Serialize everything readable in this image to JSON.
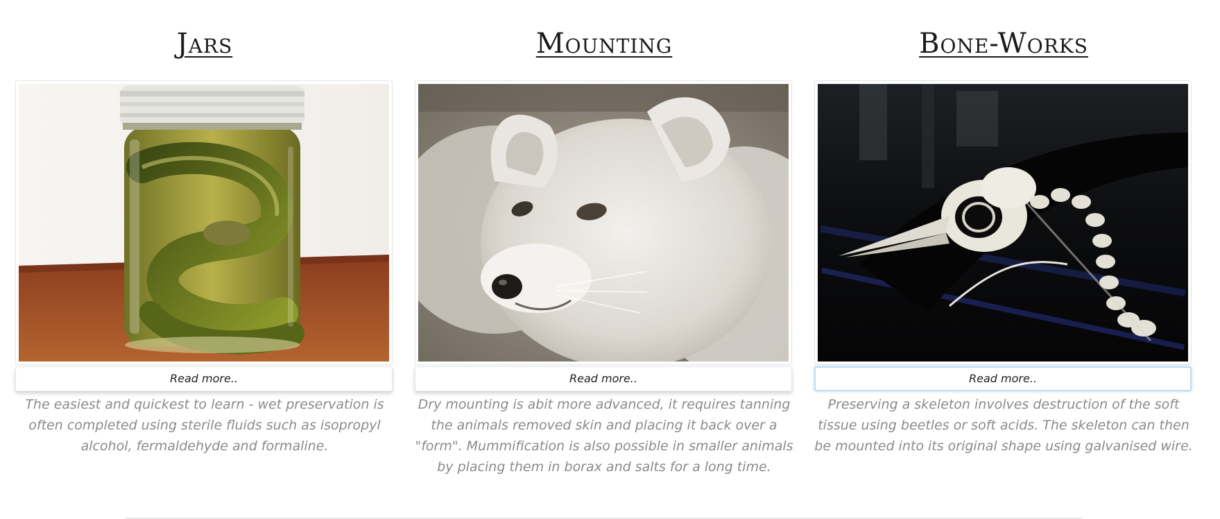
{
  "cards": [
    {
      "title": "Jars",
      "image_subject": "snake-in-jar-photo",
      "button_label": "Read more..",
      "description": "The easiest and quickest to learn - wet preservation is often completed using sterile fluids such as isopropyl alcohol, fermaldehyde and formaline."
    },
    {
      "title": "Mounting",
      "image_subject": "arctic-fox-photo",
      "button_label": "Read more..",
      "description": "Dry mounting is abit more advanced, it requires tanning the animals removed skin and placing it back over a \"form\". Mummification is also possible in smaller animals by placing them in borax and salts for a long time."
    },
    {
      "title": "Bone-Works",
      "image_subject": "bird-skeleton-photo",
      "button_label": "Read more..",
      "description": "Preserving a skeleton involves destruction of the soft tissue using beetles or soft acids. The skeleton can then be mounted into its original shape using galvanised wire."
    }
  ],
  "colors": {
    "title_text": "#1a1a1a",
    "description_text": "#8a8a8a",
    "focus_ring": "#bcdcf3"
  }
}
